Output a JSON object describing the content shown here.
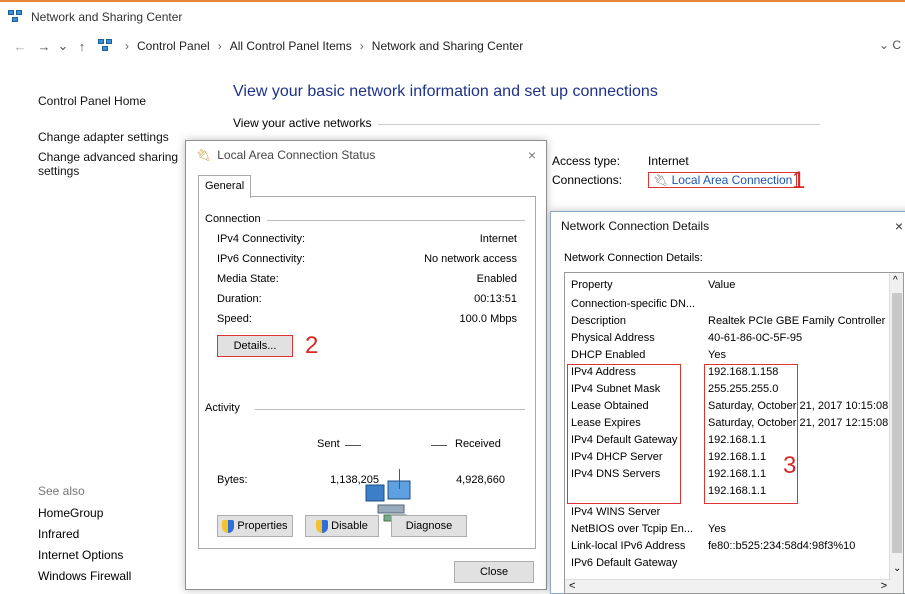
{
  "window": {
    "title": "Network and Sharing Center"
  },
  "address": {
    "back": "←",
    "forward": "→",
    "recent": "⌄",
    "up": "↑",
    "crumbs": [
      "Control Panel",
      "All Control Panel Items",
      "Network and Sharing Center"
    ],
    "sep": "›",
    "dropdown": "⌄ C"
  },
  "leftnav": {
    "home": "Control Panel Home",
    "adapter": "Change adapter settings",
    "advanced_1": "Change advanced sharing",
    "advanced_2": "settings"
  },
  "seealso": {
    "header": "See also",
    "items": [
      "HomeGroup",
      "Infrared",
      "Internet Options",
      "Windows Firewall"
    ]
  },
  "main": {
    "heading": "View your basic network information and set up connections",
    "active_networks": "View your active networks",
    "access_type_label": "Access type:",
    "access_type_value": "Internet",
    "connections_label": "Connections:",
    "connection_link": "Local Area Connection"
  },
  "callouts": [
    "1",
    "2",
    "3"
  ],
  "status_dialog": {
    "title": "Local Area Connection Status",
    "close": "×",
    "tab": "General",
    "connection_group": "Connection",
    "rows": [
      {
        "label": "IPv4 Connectivity:",
        "value": "Internet"
      },
      {
        "label": "IPv6 Connectivity:",
        "value": "No network access"
      },
      {
        "label": "Media State:",
        "value": "Enabled"
      },
      {
        "label": "Duration:",
        "value": "00:13:51"
      },
      {
        "label": "Speed:",
        "value": "100.0 Mbps"
      }
    ],
    "details_button": "Details...",
    "activity_group": "Activity",
    "sent": "Sent",
    "received": "Received",
    "bytes_label": "Bytes:",
    "bytes_sent": "1,138,205",
    "bytes_received": "4,928,660",
    "properties_button": "Properties",
    "disable_button": "Disable",
    "diagnose_button": "Diagnose",
    "close_button": "Close"
  },
  "details_dialog": {
    "title": "Network Connection Details",
    "close": "×",
    "label": "Network Connection Details:",
    "columns": [
      "Property",
      "Value"
    ],
    "rows": [
      {
        "property": "Connection-specific DN...",
        "value": ""
      },
      {
        "property": "Description",
        "value": "Realtek PCIe GBE Family Controller"
      },
      {
        "property": "Physical Address",
        "value": "40-61-86-0C-5F-95"
      },
      {
        "property": "DHCP Enabled",
        "value": "Yes"
      },
      {
        "property": "IPv4 Address",
        "value": "192.168.1.158"
      },
      {
        "property": "IPv4 Subnet Mask",
        "value": "255.255.255.0"
      },
      {
        "property": "Lease Obtained",
        "value": "Saturday, October 21, 2017 10:15:08"
      },
      {
        "property": "Lease Expires",
        "value": "Saturday, October 21, 2017 12:15:08"
      },
      {
        "property": "IPv4 Default Gateway",
        "value": "192.168.1.1"
      },
      {
        "property": "IPv4 DHCP Server",
        "value": "192.168.1.1"
      },
      {
        "property": "IPv4 DNS Servers",
        "value": "192.168.1.1"
      },
      {
        "property": "",
        "value": "192.168.1.1"
      },
      {
        "property": "IPv4 WINS Server",
        "value": ""
      },
      {
        "property": "NetBIOS over Tcpip En...",
        "value": "Yes"
      },
      {
        "property": "Link-local IPv6 Address",
        "value": "fe80::b525:234:58d4:98f3%10"
      },
      {
        "property": "IPv6 Default Gateway",
        "value": ""
      }
    ],
    "scroll_up": "^",
    "scroll_down": "⌄",
    "scroll_left": "<",
    "scroll_right": ">"
  },
  "colors": {
    "heading": "#1e3287",
    "link": "#1a55b5",
    "annotation": "#d62828",
    "titlebar_accent": "#e8873a"
  }
}
